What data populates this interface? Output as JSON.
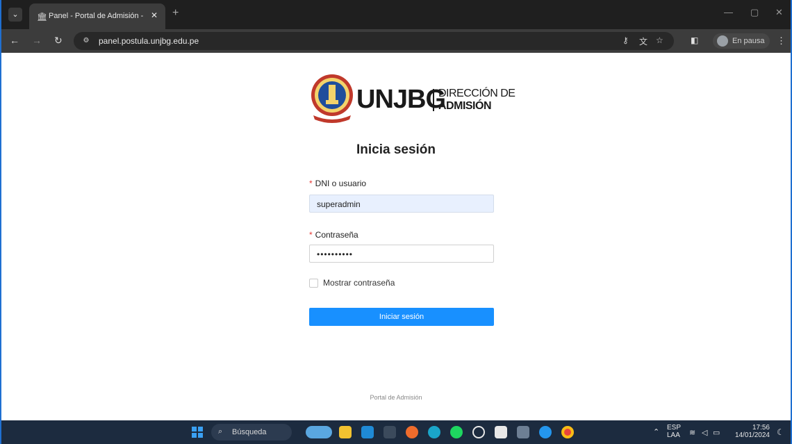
{
  "browser": {
    "tab_title": "Panel - Portal de Admisión - UN",
    "tab_favicon": "landmark-icon",
    "url": "panel.postula.unjbg.edu.pe",
    "profile_label": "En pausa"
  },
  "logo": {
    "brand": "UNJBG",
    "sub_line1": "DIRECCIÓN DE",
    "sub_line2": "ADMISIÓN"
  },
  "form": {
    "heading": "Inicia sesión",
    "username_label": "DNI o usuario",
    "username_value": "superadmin",
    "password_label": "Contraseña",
    "password_value": "••••••••••",
    "show_password_label": "Mostrar contraseña",
    "submit_label": "Iniciar sesión",
    "required_marker": "*"
  },
  "footer": {
    "text": "Portal de Admisión"
  },
  "taskbar": {
    "search_label": "Búsqueda",
    "lang_line1": "ESP",
    "lang_line2": "LAA",
    "time": "17:56",
    "date": "14/01/2024"
  },
  "colors": {
    "primary_button": "#1890ff",
    "autofill_bg": "#e8f0fe",
    "required": "#e53935"
  }
}
